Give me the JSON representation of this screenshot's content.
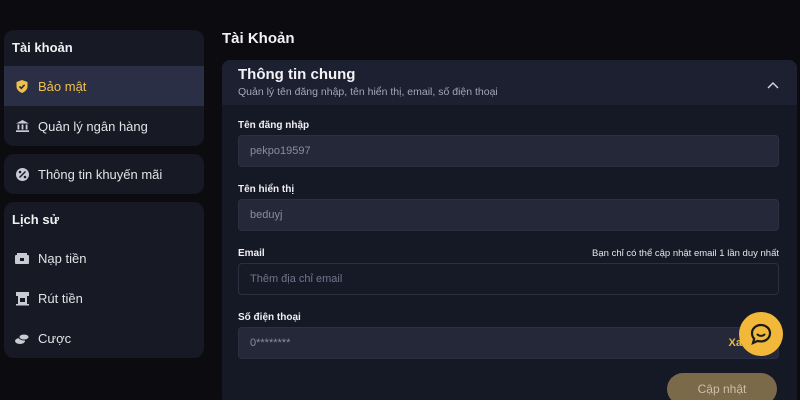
{
  "sidebar": {
    "account": {
      "title": "Tài khoản",
      "items": [
        {
          "label": "Bảo mật",
          "icon": "shield-check-icon"
        },
        {
          "label": "Quản lý ngân hàng",
          "icon": "bank-icon"
        }
      ]
    },
    "promo": {
      "label": "Thông tin khuyến mãi",
      "icon": "percent-badge-icon"
    },
    "history": {
      "title": "Lịch sử",
      "items": [
        {
          "label": "Nạp tiền",
          "icon": "deposit-icon"
        },
        {
          "label": "Rút tiền",
          "icon": "withdraw-icon"
        },
        {
          "label": "Cược",
          "icon": "bet-icon"
        }
      ]
    }
  },
  "main": {
    "page_title": "Tài Khoản",
    "card": {
      "title": "Thông tin chung",
      "subtitle": "Quản lý tên đăng nhập, tên hiển thị, email, số điện thoại",
      "fields": {
        "username": {
          "label": "Tên đăng nhập",
          "value": "pekpo19597"
        },
        "display_name": {
          "label": "Tên hiển thị",
          "value": "beduyj"
        },
        "email": {
          "label": "Email",
          "hint": "Bạn chỉ có thể cập nhật email 1 lần duy nhất",
          "placeholder": "Thêm địa chỉ email"
        },
        "phone": {
          "label": "Số điện thoại",
          "value": "0********",
          "action": "Xa"
        }
      },
      "update_label": "Cập nhật"
    }
  },
  "colors": {
    "accent": "#f0c04a",
    "panel": "#171a24",
    "active": "#2a2f45",
    "fab": "#f2b83a"
  }
}
